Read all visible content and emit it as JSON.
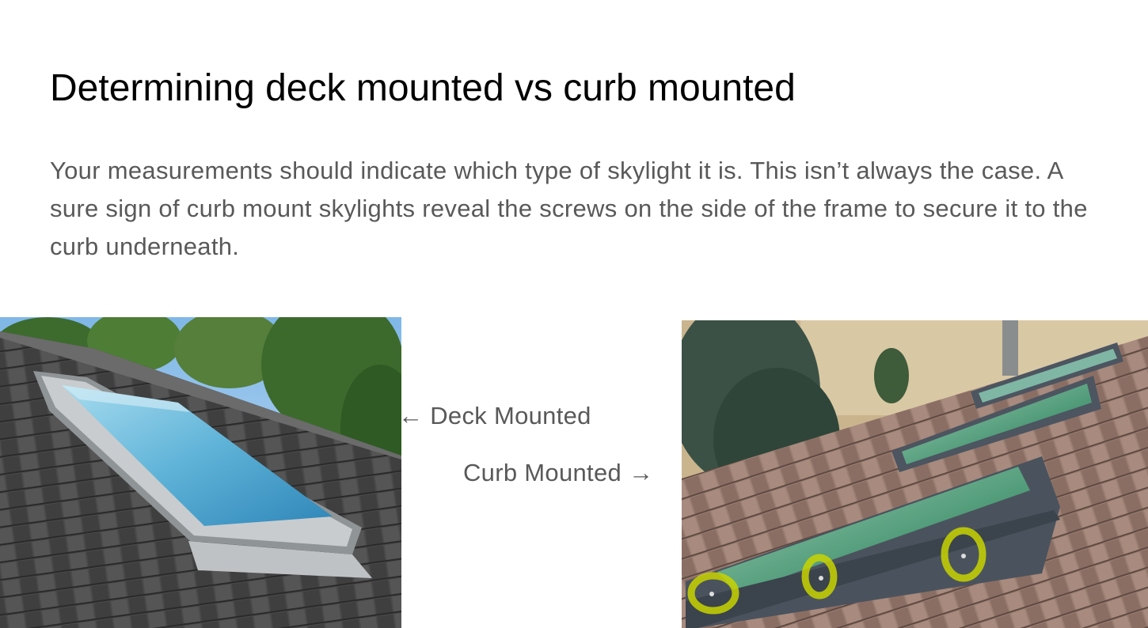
{
  "slide": {
    "title": "Determining deck mounted vs curb mounted",
    "body": "Your measurements should indicate which type of skylight it is.  This isn’t always the case. A sure sign of curb mount skylights reveal the screws on the side of the frame to secure it to the curb underneath.",
    "deck_label": "← Deck Mounted",
    "curb_label": "Curb Mounted →"
  },
  "images": {
    "left": "deck-mounted-skylight-photo",
    "right": "curb-mounted-skylights-photo"
  },
  "colors": {
    "title": "#000000",
    "body_text": "#595959",
    "screw_highlight": "#c8d400"
  }
}
